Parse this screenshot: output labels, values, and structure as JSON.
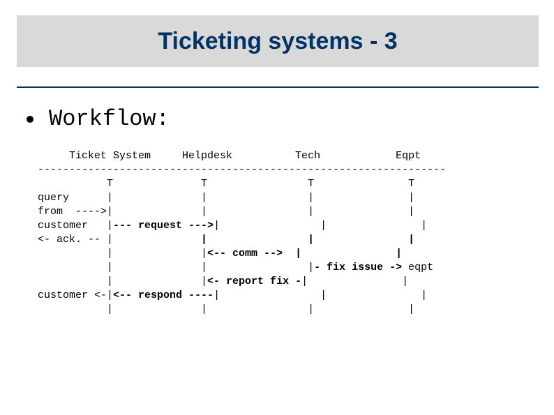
{
  "title": "Ticketing systems - 3",
  "bullet": "Workflow:",
  "workflow": {
    "header": "     Ticket System     Helpdesk          Tech            Eqpt",
    "divider": "-----------------------------------------------------------------",
    "l1_a": "           T              T                T               T",
    "l2_a": "query      |              |                |               |",
    "l3_a": "from  ---->|              |                |               |",
    "l4_a": "customer   |",
    "l4_b": "--- request --->",
    "l4_c": "|                |               |",
    "l5_a": "<- ack. -- |              ",
    "l5_b": "|                |               |",
    "l6_a": "           |              |",
    "l6_b": "<-- comm -->  ",
    "l6_c": "|               |",
    "l7_a": "           |              |                |",
    "l7_b": "- fix issue -> ",
    "l7_c": "eqpt",
    "l8_a": "           |              |",
    "l8_b": "<- report fix -",
    "l8_c": "|               |",
    "l9_a": "customer <-|",
    "l9_b": "<-- respond ----",
    "l9_c": "|                |               |",
    "l10_a": "           |              |                |               |"
  }
}
